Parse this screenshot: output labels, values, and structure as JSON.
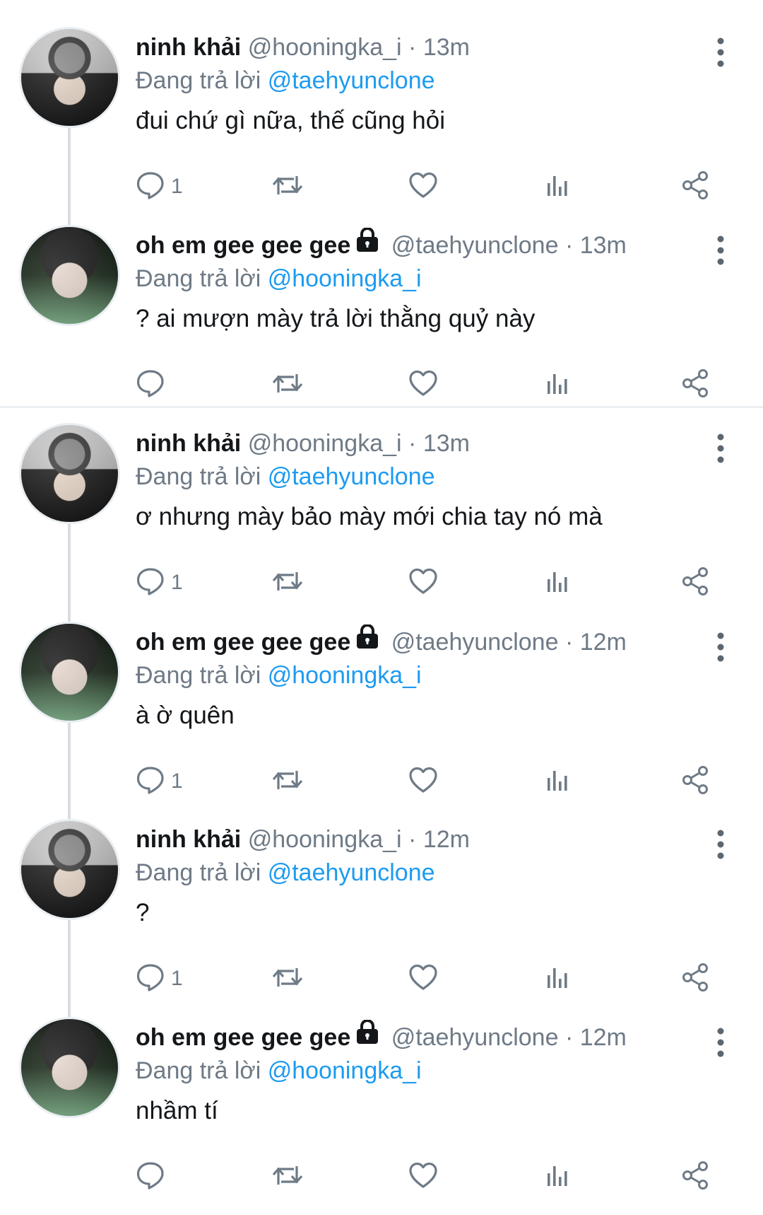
{
  "threads": [
    {
      "tweets": [
        {
          "name": "ninh khải",
          "handle": "@hooningka_i",
          "time": "· 13m",
          "reply_label": "Đang trả lời",
          "reply_to": "@taehyunclone",
          "text": "đui chứ gì nữa, thế cũng hỏi",
          "reply_count": "1",
          "protected": false,
          "avatar": "avatar-beanie-boy"
        },
        {
          "name": "oh em gee gee gee",
          "handle": "@taehyunclone",
          "time": "· 13m",
          "reply_label": "Đang trả lời",
          "reply_to": "@hooningka_i",
          "text": "? ai mượn mày trả lời thằng quỷ này",
          "reply_count": "",
          "protected": true,
          "avatar": "avatar-green-light-boy"
        }
      ]
    },
    {
      "tweets": [
        {
          "name": "ninh khải",
          "handle": "@hooningka_i",
          "time": "· 13m",
          "reply_label": "Đang trả lời",
          "reply_to": "@taehyunclone",
          "text": "ơ nhưng mày bảo mày mới chia tay nó mà",
          "reply_count": "1",
          "protected": false,
          "avatar": "avatar-beanie-boy"
        },
        {
          "name": "oh em gee gee gee",
          "handle": "@taehyunclone",
          "time": "· 12m",
          "reply_label": "Đang trả lời",
          "reply_to": "@hooningka_i",
          "text": "à ờ quên",
          "reply_count": "1",
          "protected": true,
          "avatar": "avatar-green-light-boy"
        },
        {
          "name": "ninh khải",
          "handle": "@hooningka_i",
          "time": "· 12m",
          "reply_label": "Đang trả lời",
          "reply_to": "@taehyunclone",
          "text": "?",
          "reply_count": "1",
          "protected": false,
          "avatar": "avatar-beanie-boy"
        },
        {
          "name": "oh em gee gee gee",
          "handle": "@taehyunclone",
          "time": "· 12m",
          "reply_label": "Đang trả lời",
          "reply_to": "@hooningka_i",
          "text": "nhầm tí",
          "reply_count": "",
          "protected": true,
          "avatar": "avatar-green-light-boy"
        }
      ]
    }
  ],
  "icons": {
    "reply": "reply-bubble-icon",
    "retweet": "retweet-icon",
    "like": "heart-icon",
    "stats": "stats-bars-icon",
    "share": "share-icon",
    "more": "more-vertical-icon",
    "lock": "lock-icon"
  },
  "colors": {
    "link": "#1d9bf0",
    "secondary_text": "#6e7a86",
    "primary_text": "#14171a",
    "thread_line": "#d9dde1"
  }
}
